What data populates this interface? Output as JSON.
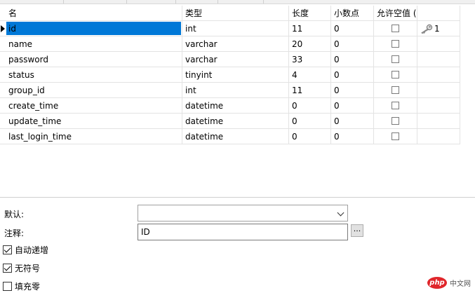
{
  "columns": {
    "name": "名",
    "type": "类型",
    "length": "长度",
    "decimals": "小数点",
    "allow_null": "允许空值 ("
  },
  "fields": [
    {
      "name": "id",
      "type": "int",
      "length": "11",
      "decimals": "0",
      "not_null": false,
      "key": "1",
      "selected": true
    },
    {
      "name": "name",
      "type": "varchar",
      "length": "20",
      "decimals": "0",
      "not_null": false,
      "key": ""
    },
    {
      "name": "password",
      "type": "varchar",
      "length": "33",
      "decimals": "0",
      "not_null": false,
      "key": ""
    },
    {
      "name": "status",
      "type": "tinyint",
      "length": "4",
      "decimals": "0",
      "not_null": false,
      "key": ""
    },
    {
      "name": "group_id",
      "type": "int",
      "length": "11",
      "decimals": "0",
      "not_null": false,
      "key": ""
    },
    {
      "name": "create_time",
      "type": "datetime",
      "length": "0",
      "decimals": "0",
      "not_null": false,
      "key": ""
    },
    {
      "name": "update_time",
      "type": "datetime",
      "length": "0",
      "decimals": "0",
      "not_null": false,
      "key": ""
    },
    {
      "name": "last_login_time",
      "type": "datetime",
      "length": "0",
      "decimals": "0",
      "not_null": false,
      "key": ""
    }
  ],
  "props": {
    "default_label": "默认:",
    "default_value": "",
    "comment_label": "注释:",
    "comment_value": "ID",
    "dots_label": "...",
    "auto_increment_label": "自动递增",
    "auto_increment_checked": true,
    "unsigned_label": "无符号",
    "unsigned_checked": true,
    "zerofill_label": "填充零",
    "zerofill_checked": false
  },
  "watermark": {
    "logo": "php",
    "site": "中文网"
  },
  "icons": {
    "primary_key": "key-icon",
    "dropdown": "chevron-down-icon",
    "row_pointer": "row-pointer-icon"
  }
}
